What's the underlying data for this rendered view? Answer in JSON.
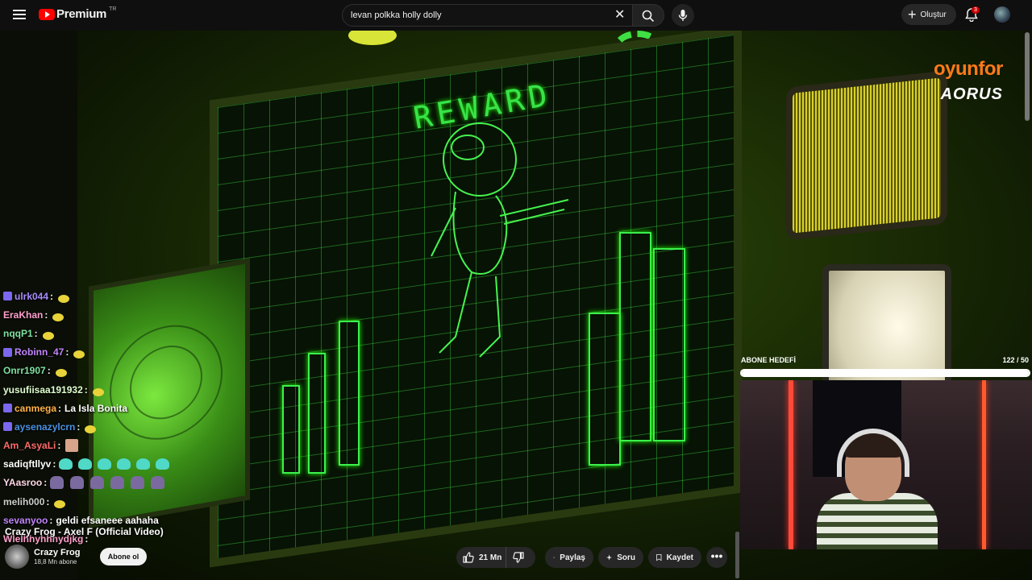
{
  "header": {
    "logo_text": "Premium",
    "country_code": "TR",
    "search_value": "levan polkka holly dolly",
    "clear_symbol": "✕",
    "create_label": "Oluştur",
    "notification_count": "3"
  },
  "video": {
    "screen_text": "REWARD",
    "title": "Crazy Frog - Axel F (Official Video)",
    "channel_name": "Crazy Frog",
    "channel_subs": "18,8 Mn abone",
    "subscribe_label": "Abone ol",
    "like_count": "21 Mn",
    "share_label": "Paylaş",
    "ask_label": "Soru",
    "save_label": "Kaydet",
    "more_label": "•••"
  },
  "overlay": {
    "sponsor_1": "oyunfor",
    "sponsor_2": "AORUS",
    "goal_label": "ABONE HEDEFİ",
    "goal_count": "122 / 50",
    "goal_progress": 1.0
  },
  "chat": [
    {
      "user": "ulrk044",
      "color": "#a78bfa",
      "badge": true,
      "message": "",
      "emotes": "yellow1"
    },
    {
      "user": "EraKhan",
      "color": "#ff9ecb",
      "badge": false,
      "message": "",
      "emotes": "yellow1"
    },
    {
      "user": "nqqP1",
      "color": "#7ee0a1",
      "badge": false,
      "message": "",
      "emotes": "yellow1"
    },
    {
      "user": "Robinn_47",
      "color": "#c084fc",
      "badge": true,
      "message": "",
      "emotes": "yellow1"
    },
    {
      "user": "Onrr1907",
      "color": "#7ee0a1",
      "badge": false,
      "message": "",
      "emotes": "yellow1"
    },
    {
      "user": "yusufiisaa191932",
      "color": "#e0ffd0",
      "badge": false,
      "message": "",
      "emotes": "yellow1"
    },
    {
      "user": "canmega",
      "color": "#ffb347",
      "badge": true,
      "message": "La Isla Bonita",
      "emotes": ""
    },
    {
      "user": "aysenazylcrn",
      "color": "#4a90e2",
      "badge": true,
      "message": "",
      "emotes": "yellow1"
    },
    {
      "user": "Am_AsyaLi",
      "color": "#ff6b6b",
      "badge": false,
      "message": "",
      "emotes": "face"
    },
    {
      "user": "sadiqftllyv",
      "color": "#ffffff",
      "badge": false,
      "message": "",
      "emotes": "blob6"
    },
    {
      "user": "YAasroo",
      "color": "#ffd6e7",
      "badge": false,
      "message": "",
      "emotes": "purple6"
    },
    {
      "user": "melih000",
      "color": "#cccccc",
      "badge": false,
      "message": "",
      "emotes": "yellow1"
    },
    {
      "user": "sevanyoo",
      "color": "#c084fc",
      "badge": false,
      "message": "geldi efsaneee aahaha",
      "emotes": ""
    },
    {
      "user": "Wlelhhyhhhydjkg",
      "color": "#ff9ecb",
      "badge": false,
      "message": "",
      "emotes": ""
    }
  ]
}
